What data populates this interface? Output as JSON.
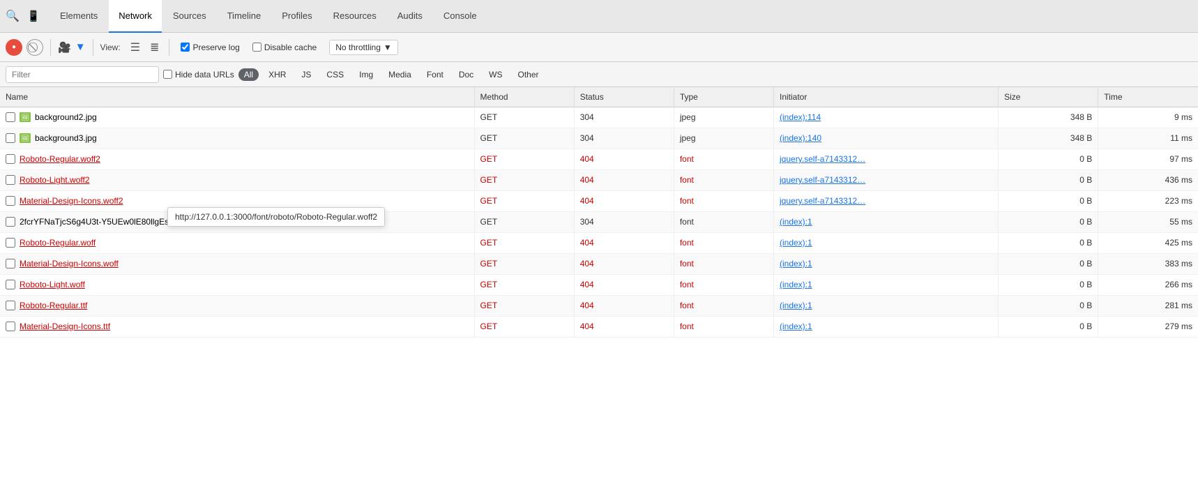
{
  "tabs": [
    {
      "label": "Elements",
      "active": false
    },
    {
      "label": "Network",
      "active": true
    },
    {
      "label": "Sources",
      "active": false
    },
    {
      "label": "Timeline",
      "active": false
    },
    {
      "label": "Profiles",
      "active": false
    },
    {
      "label": "Resources",
      "active": false
    },
    {
      "label": "Audits",
      "active": false
    },
    {
      "label": "Console",
      "active": false
    }
  ],
  "toolbar": {
    "view_label": "View:",
    "preserve_log_label": "Preserve log",
    "disable_cache_label": "Disable cache",
    "throttle_label": "No throttling",
    "preserve_log_checked": true,
    "disable_cache_checked": false
  },
  "filter": {
    "placeholder": "Filter",
    "hide_data_urls_label": "Hide data URLs",
    "type_buttons": [
      {
        "label": "All",
        "active": true
      },
      {
        "label": "XHR",
        "active": false
      },
      {
        "label": "JS",
        "active": false
      },
      {
        "label": "CSS",
        "active": false
      },
      {
        "label": "Img",
        "active": false
      },
      {
        "label": "Media",
        "active": false
      },
      {
        "label": "Font",
        "active": false
      },
      {
        "label": "Doc",
        "active": false
      },
      {
        "label": "WS",
        "active": false
      },
      {
        "label": "Other",
        "active": false
      }
    ]
  },
  "table": {
    "columns": [
      {
        "key": "name",
        "label": "Name"
      },
      {
        "key": "method",
        "label": "Method"
      },
      {
        "key": "status",
        "label": "Status"
      },
      {
        "key": "type",
        "label": "Type"
      },
      {
        "key": "initiator",
        "label": "Initiator"
      },
      {
        "key": "size",
        "label": "Size"
      },
      {
        "key": "time",
        "label": "Time"
      }
    ],
    "rows": [
      {
        "name": "background2.jpg",
        "method": "GET",
        "status": "304",
        "type": "jpeg",
        "initiator": "(index):114",
        "size": "348 B",
        "time": "9 ms",
        "is_error": false,
        "has_icon": true,
        "initiator_link": true
      },
      {
        "name": "background3.jpg",
        "method": "GET",
        "status": "304",
        "type": "jpeg",
        "initiator": "(index):140",
        "size": "348 B",
        "time": "11 ms",
        "is_error": false,
        "has_icon": true,
        "initiator_link": true
      },
      {
        "name": "Roboto-Regular.woff2",
        "method": "GET",
        "status": "404",
        "type": "font",
        "initiator": "jquery.self-a7143312…",
        "size": "0 B",
        "time": "97 ms",
        "is_error": true,
        "has_icon": false,
        "initiator_link": true
      },
      {
        "name": "Roboto-Light.woff2",
        "method": "GET",
        "status": "404",
        "type": "font",
        "initiator": "jquery.self-a7143312…",
        "size": "0 B",
        "time": "436 ms",
        "is_error": true,
        "has_icon": false,
        "initiator_link": true
      },
      {
        "name": "Material-Design-Icons.woff2",
        "method": "GET",
        "status": "404",
        "type": "font",
        "initiator": "jquery.self-a7143312…",
        "size": "0 B",
        "time": "223 ms",
        "is_error": true,
        "has_icon": false,
        "initiator_link": true
      },
      {
        "name": "2fcrYFNaTjcS6g4U3t-Y5UEw0lE80llgEseQY3FE…",
        "method": "GET",
        "status": "304",
        "type": "font",
        "initiator": "(index):1",
        "size": "0 B",
        "time": "55 ms",
        "is_error": false,
        "has_icon": false,
        "initiator_link": true
      },
      {
        "name": "Roboto-Regular.woff",
        "method": "GET",
        "status": "404",
        "type": "font",
        "initiator": "(index):1",
        "size": "0 B",
        "time": "425 ms",
        "is_error": true,
        "has_icon": false,
        "initiator_link": true
      },
      {
        "name": "Material-Design-Icons.woff",
        "method": "GET",
        "status": "404",
        "type": "font",
        "initiator": "(index):1",
        "size": "0 B",
        "time": "383 ms",
        "is_error": true,
        "has_icon": false,
        "initiator_link": true
      },
      {
        "name": "Roboto-Light.woff",
        "method": "GET",
        "status": "404",
        "type": "font",
        "initiator": "(index):1",
        "size": "0 B",
        "time": "266 ms",
        "is_error": true,
        "has_icon": false,
        "initiator_link": true
      },
      {
        "name": "Roboto-Regular.ttf",
        "method": "GET",
        "status": "404",
        "type": "font",
        "initiator": "(index):1",
        "size": "0 B",
        "time": "281 ms",
        "is_error": true,
        "has_icon": false,
        "initiator_link": true
      },
      {
        "name": "Material-Design-Icons.ttf",
        "method": "GET",
        "status": "404",
        "type": "font",
        "initiator": "(index):1",
        "size": "0 B",
        "time": "279 ms",
        "is_error": true,
        "has_icon": false,
        "initiator_link": true
      }
    ]
  },
  "tooltip": {
    "text": "http://127.0.0.1:3000/font/roboto/Roboto-Regular.woff2"
  }
}
